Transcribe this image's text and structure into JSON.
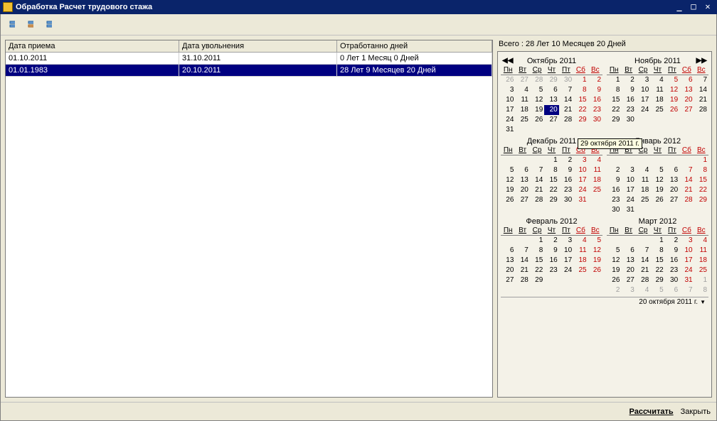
{
  "window": {
    "title": "Обработка  Расчет трудового стажа"
  },
  "grid": {
    "headers": {
      "hire": "Дата приема",
      "fire": "Дата увольнения",
      "worked": "Отработанно дней"
    },
    "rows": [
      {
        "hire": "01.10.2011",
        "fire": "31.10.2011",
        "worked": "0 Лет 1 Месяц 0 Дней"
      },
      {
        "hire": "01.01.1983",
        "fire": "20.10.2011",
        "worked": "28 Лет 9 Месяцев 20 Дней"
      }
    ]
  },
  "summary": "Всего : 28 Лет 10 Месяцев 20 Дней",
  "dow": [
    "Пн",
    "Вт",
    "Ср",
    "Чт",
    "Пт",
    "Сб",
    "Вс"
  ],
  "months": [
    {
      "title": "Октябрь 2011",
      "nav": "l",
      "lead": [
        "26",
        "27",
        "28",
        "29",
        "30"
      ],
      "days": 31,
      "redFrom": 1,
      "redExtra": [
        8,
        9,
        15,
        16,
        22,
        23,
        29,
        30
      ],
      "today": 20
    },
    {
      "title": "Ноябрь 2011",
      "nav": "r",
      "lead": [],
      "days": 30,
      "redExtra": [
        5,
        6,
        12,
        13,
        19,
        20,
        26,
        27
      ]
    },
    {
      "title": "Декабрь 2011",
      "lead": [
        "",
        "",
        ""
      ],
      "days": 31,
      "redExtra": [
        3,
        4,
        10,
        11,
        17,
        18,
        24,
        25,
        31
      ]
    },
    {
      "title": "Январь 2012",
      "lead": [
        "",
        "",
        "",
        "",
        "",
        ""
      ],
      "days": 31,
      "redExtra": [
        1,
        7,
        8,
        14,
        15,
        21,
        22,
        28,
        29
      ]
    },
    {
      "title": "Февраль 2012",
      "lead": [
        "",
        ""
      ],
      "days": 29,
      "redExtra": [
        4,
        5,
        11,
        12,
        18,
        19,
        25,
        26
      ]
    },
    {
      "title": "Март 2012",
      "lead": [
        "",
        "",
        ""
      ],
      "days": 31,
      "redExtra": [
        3,
        4,
        10,
        11,
        17,
        18,
        24,
        25,
        31
      ],
      "trail": [
        "1",
        "2",
        "3",
        "4",
        "5",
        "6",
        "7",
        "8"
      ]
    }
  ],
  "tooltip": "29 октября 2011 г.",
  "datebar": "20 октября 2011 г.",
  "footer": {
    "calc": "Рассчитать",
    "close": "Закрыть"
  }
}
